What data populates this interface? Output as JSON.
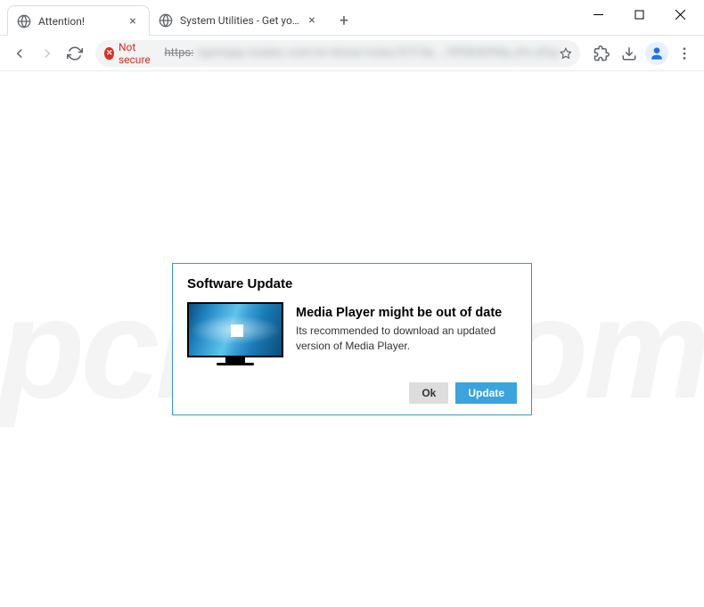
{
  "tabs": [
    {
      "title": "Attention!",
      "active": true
    },
    {
      "title": "System Utilities - Get your PC in",
      "active": false
    }
  ],
  "url_bar": {
    "security_label": "Not secure",
    "protocol": "https:",
    "blurred": "/gxmqay.nsalex.com/w/show/roles/3/f/3a.../095h$394y.yfo.efoy"
  },
  "dialog": {
    "title": "Software Update",
    "heading": "Media Player might be out of date",
    "description": "Its recommended to download an updated version of Media Player.",
    "ok_label": "Ok",
    "update_label": "Update"
  },
  "watermark": "pcrisk.com"
}
